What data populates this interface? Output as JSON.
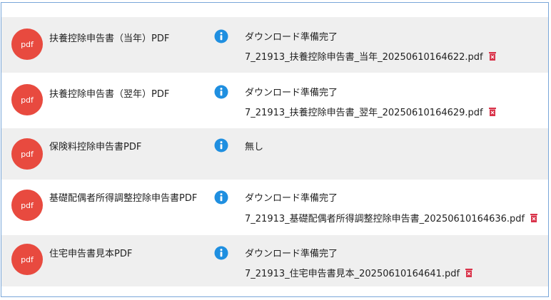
{
  "badge_label": "pdf",
  "colors": {
    "badge": "#e84a3f",
    "info": "#1f8fe0",
    "delete": "#d9334a",
    "row_alt": "#efefef"
  },
  "rows": [
    {
      "name": "扶養控除申告書（当年）PDF",
      "status": "ダウンロード準備完了",
      "file": "7_21913_扶養控除申告書_当年_20250610164622.pdf"
    },
    {
      "name": "扶養控除申告書（翌年）PDF",
      "status": "ダウンロード準備完了",
      "file": "7_21913_扶養控除申告書_翌年_20250610164629.pdf"
    },
    {
      "name": "保険料控除申告書PDF",
      "status": "無し",
      "file": ""
    },
    {
      "name": "基礎配偶者所得調整控除申告書PDF",
      "status": "ダウンロード準備完了",
      "file": "7_21913_基礎配偶者所得調整控除申告書_20250610164636.pdf"
    },
    {
      "name": "住宅申告書見本PDF",
      "status": "ダウンロード準備完了",
      "file": "7_21913_住宅申告書見本_20250610164641.pdf"
    }
  ]
}
